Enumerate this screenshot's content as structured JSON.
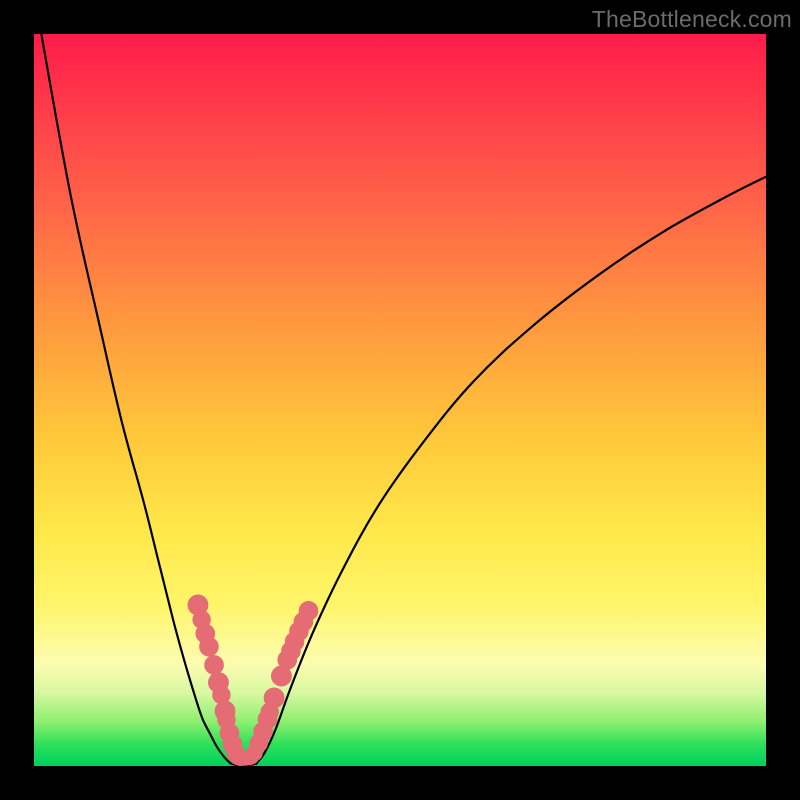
{
  "watermark": "TheBottleneck.com",
  "colors": {
    "frame": "#000000",
    "curve_stroke": "#000000",
    "marker_fill": "#e56b74",
    "marker_stroke": "#e56b74"
  },
  "chart_data": {
    "type": "line",
    "title": "",
    "xlabel": "",
    "ylabel": "",
    "xlim": [
      0,
      100
    ],
    "ylim": [
      0,
      100
    ],
    "grid": false,
    "legend": false,
    "series": [
      {
        "name": "left-branch",
        "x": [
          1,
          5,
          9,
          12,
          15,
          17,
          19,
          20.5,
          22,
          23,
          24,
          25,
          26,
          26.8
        ],
        "y": [
          100,
          78,
          60,
          47,
          36,
          28,
          20,
          14.5,
          9.5,
          6.5,
          4.5,
          2.6,
          1.2,
          0.4
        ]
      },
      {
        "name": "valley",
        "x": [
          26.8,
          27.4,
          28.0,
          28.6,
          29.2,
          29.8,
          30.4
        ],
        "y": [
          0.4,
          0.2,
          0.15,
          0.15,
          0.15,
          0.2,
          0.4
        ]
      },
      {
        "name": "right-branch",
        "x": [
          30.4,
          31.5,
          33,
          35,
          38,
          42,
          47,
          53,
          60,
          68,
          77,
          86,
          95,
          100
        ],
        "y": [
          0.4,
          1.8,
          5.0,
          10.5,
          18,
          26.5,
          35.5,
          44,
          52.5,
          60,
          67,
          73,
          78,
          80.5
        ]
      }
    ],
    "markers": [
      {
        "x": 22.4,
        "y": 22.0,
        "r": 1.6
      },
      {
        "x": 22.9,
        "y": 20.0,
        "r": 1.4
      },
      {
        "x": 23.4,
        "y": 18.1,
        "r": 1.5
      },
      {
        "x": 23.9,
        "y": 16.3,
        "r": 1.5
      },
      {
        "x": 24.6,
        "y": 13.8,
        "r": 1.5
      },
      {
        "x": 25.2,
        "y": 11.4,
        "r": 1.6
      },
      {
        "x": 25.6,
        "y": 9.7,
        "r": 1.4
      },
      {
        "x": 26.1,
        "y": 7.5,
        "r": 1.6
      },
      {
        "x": 26.3,
        "y": 6.3,
        "r": 1.4
      },
      {
        "x": 26.7,
        "y": 4.5,
        "r": 1.5
      },
      {
        "x": 27.1,
        "y": 3.0,
        "r": 1.5
      },
      {
        "x": 27.5,
        "y": 1.9,
        "r": 1.4
      },
      {
        "x": 27.8,
        "y": 1.3,
        "r": 1.3
      },
      {
        "x": 28.0,
        "y": 1.1,
        "r": 1.1
      },
      {
        "x": 28.2,
        "y": 1.0,
        "r": 1.1
      },
      {
        "x": 28.5,
        "y": 0.95,
        "r": 1.0
      },
      {
        "x": 28.8,
        "y": 0.95,
        "r": 1.0
      },
      {
        "x": 29.1,
        "y": 1.0,
        "r": 1.0
      },
      {
        "x": 29.4,
        "y": 1.1,
        "r": 1.1
      },
      {
        "x": 29.7,
        "y": 1.3,
        "r": 1.2
      },
      {
        "x": 30.1,
        "y": 1.8,
        "r": 1.3
      },
      {
        "x": 30.7,
        "y": 3.1,
        "r": 1.4
      },
      {
        "x": 31.3,
        "y": 4.7,
        "r": 1.5
      },
      {
        "x": 31.9,
        "y": 6.4,
        "r": 1.5
      },
      {
        "x": 32.2,
        "y": 7.4,
        "r": 1.4
      },
      {
        "x": 32.8,
        "y": 9.3,
        "r": 1.6
      },
      {
        "x": 33.8,
        "y": 12.3,
        "r": 1.6
      },
      {
        "x": 34.6,
        "y": 14.5,
        "r": 1.5
      },
      {
        "x": 35.1,
        "y": 15.7,
        "r": 1.5
      },
      {
        "x": 35.6,
        "y": 17.0,
        "r": 1.5
      },
      {
        "x": 36.2,
        "y": 18.4,
        "r": 1.5
      },
      {
        "x": 36.8,
        "y": 19.7,
        "r": 1.5
      },
      {
        "x": 37.5,
        "y": 21.2,
        "r": 1.5
      }
    ]
  }
}
